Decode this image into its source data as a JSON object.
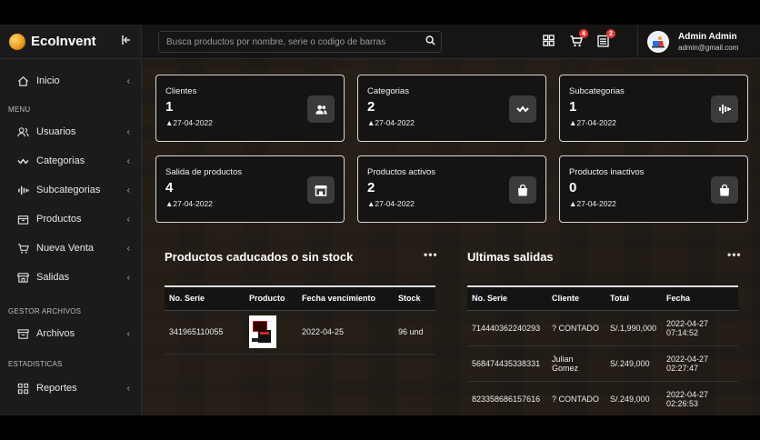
{
  "app": {
    "name": "EcoInvent"
  },
  "search": {
    "placeholder": "Busca productos por nombre, serie o codigo de barras"
  },
  "topbar": {
    "cart_badge": "4",
    "list_badge": "2"
  },
  "user": {
    "name": "Admin Admin",
    "email": "admin@gmail.com"
  },
  "sidebar": {
    "inicio": "Inicio",
    "menu_section": "MENU",
    "items": [
      "Usuarios",
      "Categorias",
      "Subcategorias",
      "Productos",
      "Nueva Venta",
      "Salidas"
    ],
    "gestor_section": "GESTOR ARCHIVOS",
    "archivos": "Archivos",
    "estadisticas_section": "ESTADISTICAS",
    "reportes": "Reportes"
  },
  "cards": [
    {
      "title": "Clientes",
      "value": "1",
      "date": "▲27-04-2022",
      "icon": "users-icon"
    },
    {
      "title": "Categorias",
      "value": "2",
      "date": "▲27-04-2022",
      "icon": "wave-icon"
    },
    {
      "title": "Subcategorias",
      "value": "1",
      "date": "▲27-04-2022",
      "icon": "bars-icon"
    },
    {
      "title": "Salida de productos",
      "value": "4",
      "date": "▲27-04-2022",
      "icon": "store-icon"
    },
    {
      "title": "Productos activos",
      "value": "2",
      "date": "▲27-04-2022",
      "icon": "bag-icon"
    },
    {
      "title": "Productos inactivos",
      "value": "0",
      "date": "▲27-04-2022",
      "icon": "bag-icon"
    }
  ],
  "expired": {
    "title": "Productos caducados o sin stock",
    "headers": [
      "No. Serie",
      "Producto",
      "Fecha vencimiento",
      "Stock"
    ],
    "rows": [
      {
        "serie": "341965110055",
        "fecha": "2022-04-25",
        "stock": "96 und"
      }
    ]
  },
  "salidas": {
    "title": "Ultimas salidas",
    "headers": [
      "No. Serie",
      "Cliente",
      "Total",
      "Fecha"
    ],
    "rows": [
      {
        "serie": "714440362240293",
        "cliente": "? CONTADO",
        "total": "S/.1,990,000",
        "fecha": "2022-04-27",
        "hora": "07:14:52"
      },
      {
        "serie": "568474435338331",
        "cliente": "Julian",
        "cliente2": "Gomez",
        "total": "S/.249,000",
        "fecha": "2022-04-27",
        "hora": "02:27:47"
      },
      {
        "serie": "823358686157616",
        "cliente": "? CONTADO",
        "total": "S/.249,000",
        "fecha": "2022-04-27",
        "hora": "02:26:53"
      }
    ]
  }
}
